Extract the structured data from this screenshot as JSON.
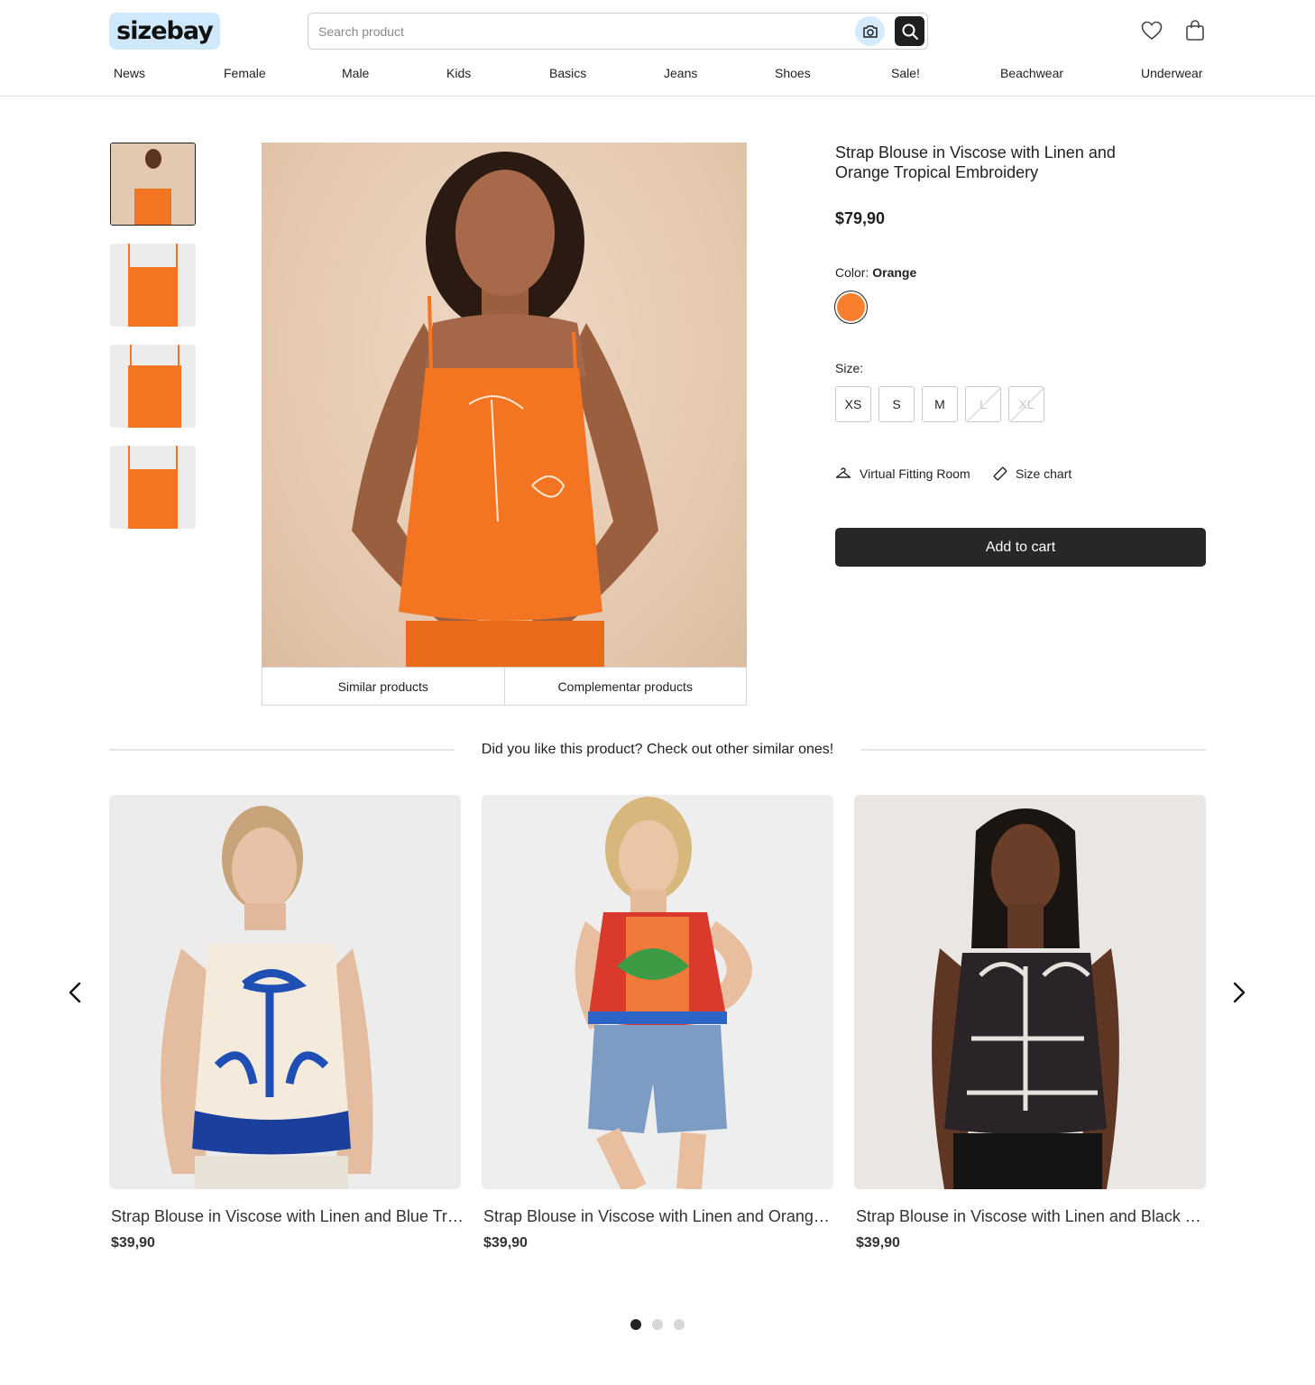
{
  "header": {
    "logo": "sizebay",
    "search_placeholder": "Search product",
    "nav": [
      "News",
      "Female",
      "Male",
      "Kids",
      "Basics",
      "Jeans",
      "Shoes",
      "Sale!",
      "Beachwear",
      "Underwear"
    ]
  },
  "product": {
    "title": "Strap Blouse in Viscose with Linen and Orange Tropical Embroidery",
    "price": "$79,90",
    "color_label": "Color:",
    "color_value": "Orange",
    "color_hex": "#f87f2e",
    "size_label": "Size:",
    "sizes": [
      {
        "label": "XS",
        "available": true
      },
      {
        "label": "S",
        "available": true
      },
      {
        "label": "M",
        "available": true
      },
      {
        "label": "L",
        "available": false
      },
      {
        "label": "XL",
        "available": false
      }
    ],
    "virtual_fitting_label": "Virtual Fitting Room",
    "size_chart_label": "Size chart",
    "add_to_cart_label": "Add to cart"
  },
  "tabs": [
    "Similar products",
    "Complementar products"
  ],
  "similar": {
    "heading": "Did you like this product? Check out other similar ones!",
    "items": [
      {
        "title": "Strap Blouse in Viscose with Linen and Blue Tropical Print",
        "price": "$39,90"
      },
      {
        "title": "Strap Blouse in Viscose with Linen and Orange Tropical Print",
        "price": "$39,90"
      },
      {
        "title": "Strap Blouse in Viscose with Linen and Black Tropical Print",
        "price": "$39,90"
      }
    ],
    "pages": 3,
    "current_page": 1
  },
  "colors": {
    "accent": "#cfe8fb",
    "dark": "#272727",
    "orange": "#f47521"
  }
}
